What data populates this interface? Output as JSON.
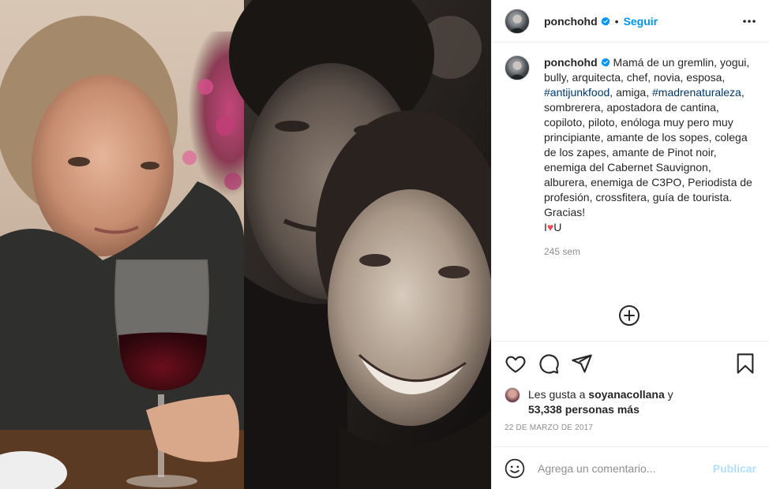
{
  "post": {
    "username": "ponchohd",
    "follow_label": "Seguir",
    "separator": "•",
    "caption_pre1": " Mamá de un gremlin, yogui, bully, arquitecta, chef, novia, esposa, ",
    "hashtag1": "#antijunkfood",
    "caption_mid": ", amiga, ",
    "hashtag2": "#madrenaturaleza",
    "caption_post": ", sombrerera, apostadora de cantina, copiloto, piloto, enóloga muy pero muy principiante, amante de los sopes, colega de los zapes, amante de Pinot noir, enemiga del Cabernet Sauvignon, alburera, enemiga de C3PO, Periodista de profesión, crossfitera, guía de tourista.",
    "caption_thanks": "Gracias!",
    "caption_love_i": "I",
    "caption_love_heart": "♥",
    "caption_love_u": "U",
    "time_ago": "245 sem",
    "likes_prefix": "Les gusta a ",
    "likes_user": "soyanacollana",
    "likes_and": " y",
    "likes_count": "53,338 personas más",
    "date": "22 DE MARZO DE 2017"
  },
  "comment": {
    "placeholder": "Agrega un comentario...",
    "publish_label": "Publicar"
  },
  "icons": {
    "verified": "verified-badge-icon",
    "more": "more-options-icon",
    "like": "heart-icon",
    "comment": "comment-icon",
    "share": "paper-plane-icon",
    "save": "bookmark-icon",
    "add": "plus-circle-icon",
    "emoji": "smiley-icon"
  },
  "colors": {
    "accent": "#0095f6",
    "hashtag": "#00376b",
    "muted": "#8e8e8e",
    "publish_disabled": "#b2dffc",
    "heart": "#ed4956"
  }
}
